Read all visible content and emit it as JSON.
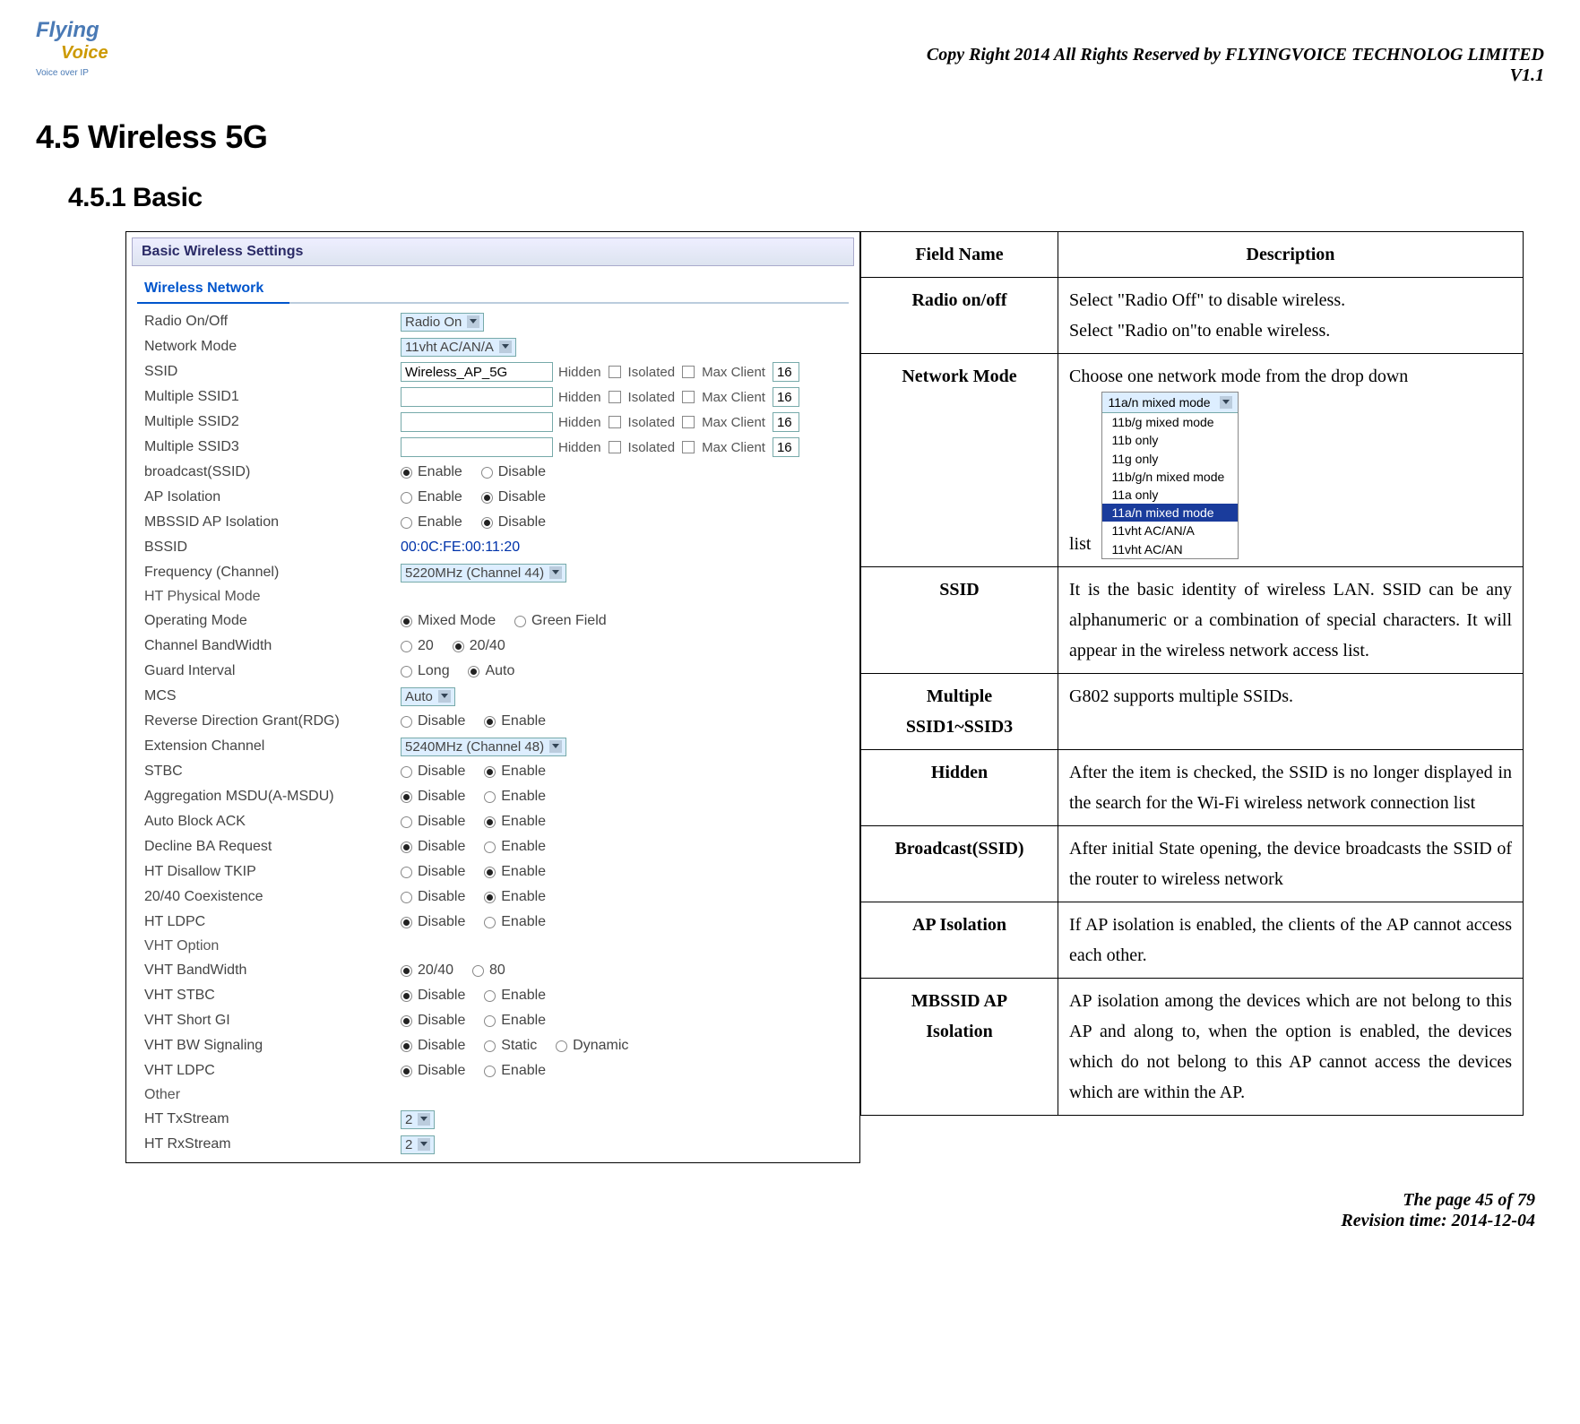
{
  "header": {
    "logo_line1": "Flying",
    "logo_line2": "Voice",
    "logo_tag": "Voice over IP",
    "copyright": "Copy Right 2014 All Rights Reserved by FLYINGVOICE TECHNOLOG LIMITED",
    "version": "V1.1"
  },
  "headings": {
    "h1": "4.5  Wireless 5G",
    "h2": "4.5.1 Basic"
  },
  "panel": {
    "title": "Basic Wireless Settings",
    "section": "Wireless Network",
    "labels": {
      "radio": "Radio On/Off",
      "network_mode": "Network Mode",
      "ssid": "SSID",
      "mssid1": "Multiple SSID1",
      "mssid2": "Multiple SSID2",
      "mssid3": "Multiple SSID3",
      "broadcast": "broadcast(SSID)",
      "ap_isolation": "AP Isolation",
      "mbssid_ap_isolation": "MBSSID AP Isolation",
      "bssid": "BSSID",
      "frequency": "Frequency (Channel)",
      "ht_physical": "HT Physical Mode",
      "operating_mode": "Operating Mode",
      "chan_bw": "Channel BandWidth",
      "guard": "Guard Interval",
      "mcs": "MCS",
      "rdg": "Reverse Direction Grant(RDG)",
      "ext_channel": "Extension Channel",
      "stbc": "STBC",
      "amsdu": "Aggregation MSDU(A-MSDU)",
      "auto_block_ack": "Auto Block ACK",
      "decline_ba": "Decline BA Request",
      "disallow_tkip": "HT Disallow TKIP",
      "coexistence": "20/40 Coexistence",
      "ht_ldpc": "HT LDPC",
      "vht_option": "VHT Option",
      "vht_bw": "VHT BandWidth",
      "vht_stbc": "VHT STBC",
      "vht_short_gi": "VHT Short GI",
      "vht_bw_sig": "VHT BW Signaling",
      "vht_ldpc": "VHT LDPC",
      "other": "Other",
      "ht_txstream": "HT TxStream",
      "ht_rxstream": "HT RxStream",
      "hidden": "Hidden",
      "isolated": "Isolated",
      "max_client": "Max Client",
      "enable": "Enable",
      "disable": "Disable",
      "mixed_mode": "Mixed Mode",
      "green_field": "Green Field",
      "bw20": "20",
      "bw2040": "20/40",
      "long": "Long",
      "auto": "Auto",
      "static": "Static",
      "dynamic": "Dynamic",
      "bw80": "80"
    },
    "values": {
      "radio": "Radio On",
      "network_mode": "11vht AC/AN/A",
      "ssid": "Wireless_AP_5G",
      "max_client": "16",
      "bssid": "00:0C:FE:00:11:20",
      "frequency": "5220MHz (Channel 44)",
      "mcs": "Auto",
      "ext_channel": "5240MHz (Channel 48)",
      "ht_txstream": "2",
      "ht_rxstream": "2"
    }
  },
  "desc_table": {
    "head_field": "Field Name",
    "head_desc": "Description",
    "rows": {
      "radio": {
        "name": "Radio on/off",
        "desc1": "Select \"Radio Off\" to disable wireless.",
        "desc2": "Select \"Radio on\"to enable wireless."
      },
      "network_mode": {
        "name": "Network Mode",
        "desc_pre": "Choose one network mode from the drop down",
        "desc_post": "list",
        "dropdown_selected": "11a/n mixed mode",
        "options": [
          "11b/g mixed mode",
          "11b only",
          "11g only",
          "11b/g/n mixed mode",
          "11a only",
          "11a/n mixed mode",
          "11vht AC/AN/A",
          "11vht AC/AN"
        ]
      },
      "ssid": {
        "name": "SSID",
        "desc": "It is the basic identity of wireless LAN. SSID can be any alphanumeric or a combination of special characters. It will appear in the wireless network access list."
      },
      "multiple_ssid": {
        "name1": "Multiple",
        "name2": "SSID1~SSID3",
        "desc": "G802 supports multiple SSIDs."
      },
      "hidden": {
        "name": "Hidden",
        "desc": "After the item is checked, the SSID is no longer displayed in the search for the Wi-Fi wireless network connection list"
      },
      "broadcast": {
        "name": "Broadcast(SSID)",
        "desc": "After initial State opening, the device broadcasts the SSID of the router to wireless network"
      },
      "ap_isolation": {
        "name": "AP Isolation",
        "desc": "If AP isolation is enabled, the clients of the AP cannot access each other."
      },
      "mbssid": {
        "name1": "MBSSID AP",
        "name2": "Isolation",
        "desc": "AP isolation among the devices which are not belong to this AP and along to, when the option is enabled, the devices which do not belong to this AP cannot access the devices which are within the AP."
      }
    }
  },
  "footer": {
    "page": "The page 45 of 79",
    "revision": "Revision time: 2014-12-04"
  }
}
